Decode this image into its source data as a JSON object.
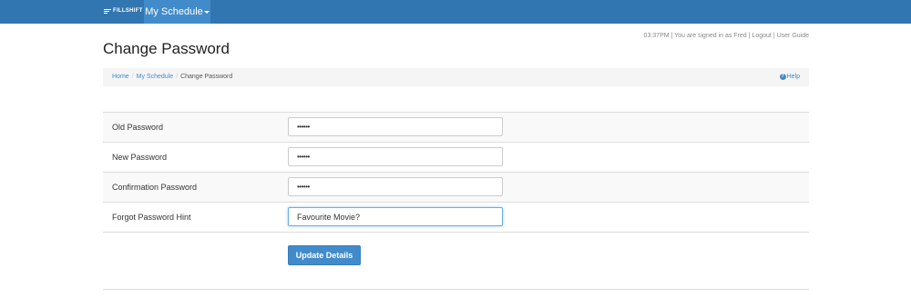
{
  "header": {
    "brand": "FILLSHIFT",
    "nav_active": "My Schedule"
  },
  "status": {
    "time": "03:37PM",
    "signed_in_text": "You are signed in as Fred",
    "logout": "Logout",
    "user_guide": "User Guide",
    "separator": "|"
  },
  "page": {
    "title": "Change Password"
  },
  "breadcrumb": {
    "items": [
      "Home",
      "My Schedule"
    ],
    "current": "Change Password",
    "separator": "/"
  },
  "help": {
    "label": "Help",
    "icon": "question-circle-icon"
  },
  "form": {
    "fields": [
      {
        "label": "Old Password",
        "value": "••••••"
      },
      {
        "label": "New Password",
        "value": "••••••"
      },
      {
        "label": "Confirmation Password",
        "value": "••••••"
      },
      {
        "label": "Forgot Password Hint",
        "value": "Favourite Movie?"
      }
    ],
    "submit_label": "Update Details"
  },
  "colors": {
    "navbar": "#3276b1",
    "nav_active": "#428bca",
    "link": "#428bca",
    "button": "#428bca"
  }
}
